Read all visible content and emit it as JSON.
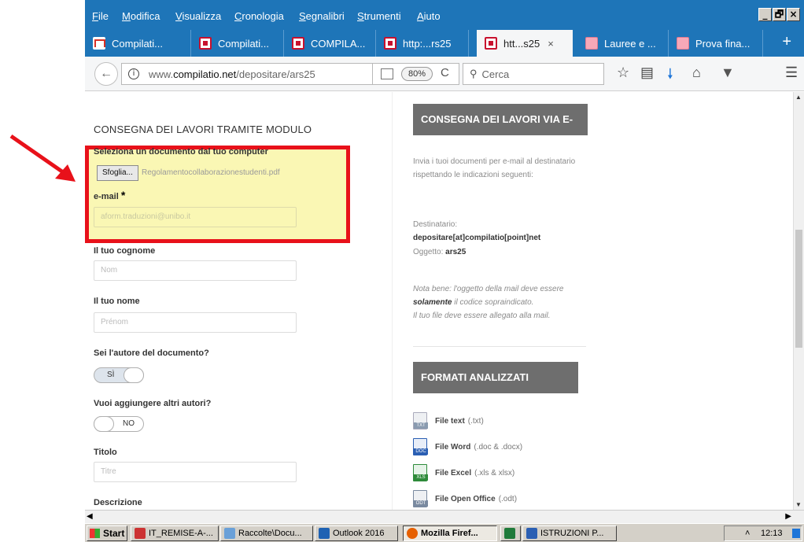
{
  "menubar": {
    "items": [
      "File",
      "Modifica",
      "Visualizza",
      "Cronologia",
      "Segnalibri",
      "Strumenti",
      "Aiuto"
    ],
    "underline": [
      "F",
      "M",
      "V",
      "C",
      "S",
      "S",
      "A"
    ],
    "rest": [
      "ile",
      "odifica",
      "isualizza",
      "ronologia",
      "egnalibri",
      "trumenti",
      "iuto"
    ],
    "window_controls": [
      "_",
      "🗗",
      "×"
    ]
  },
  "tabs": [
    {
      "label": "Compilati...",
      "icon": "gmail-icon"
    },
    {
      "label": "Compilati...",
      "icon": "compilatio-icon"
    },
    {
      "label": "COMPILA...",
      "icon": "compilatio-icon"
    },
    {
      "label": "http:...rs25",
      "icon": "compilatio-icon"
    },
    {
      "label": "htt...s25",
      "icon": "compilatio-icon",
      "active": true,
      "close": "×"
    },
    {
      "label": "Lauree e ...",
      "icon": "page-icon"
    },
    {
      "label": "Prova fina...",
      "icon": "page-icon"
    }
  ],
  "newtab": "+",
  "nav": {
    "back": "←",
    "info": "i",
    "url_prefix": "www.",
    "url_domain": "compilatio.net",
    "url_path": "/depositare/ars25",
    "zoom": "80%",
    "reload": "C",
    "search_placeholder": "Cerca",
    "icons": [
      "star-icon",
      "reading-list-icon",
      "download-icon",
      "home-icon",
      "pocket-icon",
      "menu-icon"
    ]
  },
  "form": {
    "title": "CONSEGNA DEI LAVORI TRAMITE MODULO",
    "file_label": "Seleziona un documento dal tuo computer",
    "browse_button": "Sfoglia...",
    "file_name": "Regolamentocollaborazionestudenti.pdf",
    "email_label": "e-mail",
    "required_mark": "*",
    "email_value": "aform.traduzioni@unibo.it",
    "surname_label": "Il tuo cognome",
    "surname_placeholder": "Nom",
    "name_label": "Il tuo nome",
    "name_placeholder": "Prénom",
    "author_label": "Sei l'autore del documento?",
    "author_toggle": "SÌ",
    "coauthors_label": "Vuoi aggiungere altri autori?",
    "coauthors_toggle": "NO",
    "title_label": "Titolo",
    "title_placeholder": "Titre",
    "desc_label": "Descrizione"
  },
  "sidebar": {
    "email_box_title": "CONSEGNA DEI LAVORI VIA E-MAIL",
    "email_intro": "Invia i tuoi documenti per e-mail al destinatario rispettando le indicazioni seguenti:",
    "recipient_label": "Destinatario:",
    "recipient": "depositare[at]compilatio[point]net",
    "subject_label": "Oggetto:",
    "subject": "ars25",
    "note_1": "Nota bene: l'oggetto della mail deve essere",
    "note_bold": "solamente",
    "note_2": "il codice sopraindicato.",
    "note_3": "Il tuo file deve essere allegato alla mail.",
    "formats_title": "FORMATI ANALIZZATI",
    "formats": [
      {
        "name": "File text",
        "ext": "(.txt)",
        "tag": "TXT",
        "color": "#8a9bb0"
      },
      {
        "name": "File Word",
        "ext": "(.doc & .docx)",
        "tag": "DOC",
        "color": "#2b5fb3"
      },
      {
        "name": "File Excel",
        "ext": "(.xls & xlsx)",
        "tag": "XLS",
        "color": "#2e8b3a"
      },
      {
        "name": "File Open Office",
        "ext": "(.odt)",
        "tag": "ODT",
        "color": "#7a8aa0"
      }
    ]
  },
  "taskbar": {
    "start": "Start",
    "items": [
      {
        "label": "IT_REMISE-A-...",
        "color": "#c33"
      },
      {
        "label": "Raccolte\\Docu...",
        "color": "#6aa0d8"
      },
      {
        "label": "Outlook 2016",
        "color": "#1f62b3"
      },
      {
        "label": "Mozilla Firef...",
        "color": "#e66000",
        "pressed": true
      },
      {
        "label": "",
        "color": "#1f7a3a"
      },
      {
        "label": "ISTRUZIONI P...",
        "color": "#2b5fb3"
      }
    ],
    "clock": "12:13"
  }
}
